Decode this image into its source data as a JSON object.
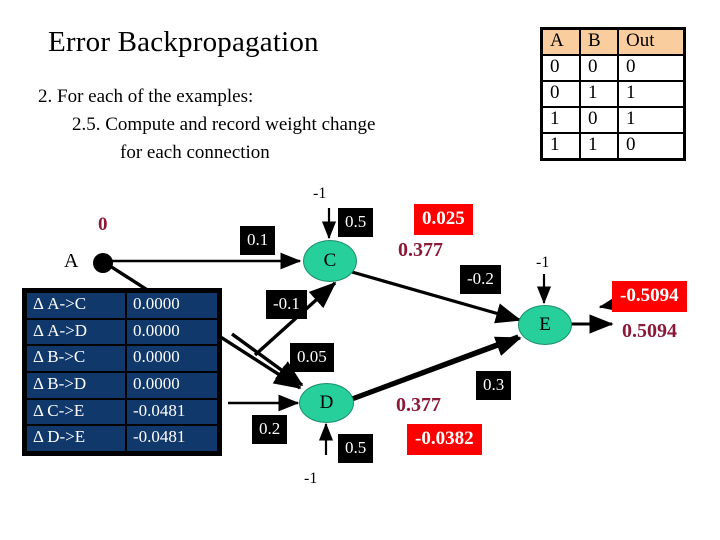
{
  "slide": {
    "title": "Error Backpropagation",
    "bullets": [
      "2. For each of the examples:",
      "2.5.  Compute and record weight change",
      "for each connection"
    ]
  },
  "truth_table": {
    "name": "xor-truth-table",
    "headers": [
      "A",
      "B",
      "Out"
    ],
    "rows": [
      [
        "0",
        "0",
        "0"
      ],
      [
        "0",
        "1",
        "1"
      ],
      [
        "1",
        "0",
        "1"
      ],
      [
        "1",
        "1",
        "0"
      ]
    ],
    "header_bg": "#facd9e"
  },
  "delta_table": {
    "name": "weight-change-table",
    "bg": "#10386b",
    "text_color": "#ffffff",
    "rows": [
      {
        "label": "Δ A->C",
        "value": "0.0000"
      },
      {
        "label": "Δ A->D",
        "value": "0.0000"
      },
      {
        "label": "Δ B->C",
        "value": "0.0000"
      },
      {
        "label": "Δ B->D",
        "value": "0.0000"
      },
      {
        "label": "Δ C->E",
        "value": "-0.0481"
      },
      {
        "label": "Δ D->E",
        "value": "-0.0481"
      }
    ]
  },
  "network": {
    "nodes": {
      "a_label": "A",
      "c": "C",
      "d": "D",
      "e": "E"
    },
    "input_value_a": "0",
    "weights": {
      "a_to_c": "0.1",
      "a_to_d": "-0.1",
      "b_to_c": "0.5",
      "b_to_d": "0.05",
      "bias_in_c": "-1",
      "bias_in_d": "-1",
      "bias_in_e": "-1",
      "c_bias_weight": "0.5",
      "d_in_left": "0.2",
      "d_bias_weight": "0.5",
      "c_to_e": "-0.2",
      "d_to_e": "0.3"
    },
    "activations": {
      "c_out": "0.377",
      "d_out": "0.377",
      "e_out": "0.5094"
    },
    "errors": {
      "c_error": "0.025",
      "d_error": "-0.0382",
      "e_error": "-0.5094"
    },
    "colors": {
      "node_fill": "#27cf9a",
      "weight_chip_bg": "#000000",
      "error_chip_bg": "#ff0000",
      "activation_text": "#8b1a38"
    }
  }
}
